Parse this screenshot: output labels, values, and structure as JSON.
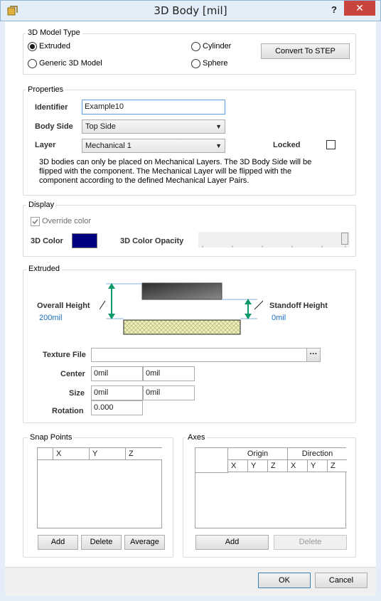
{
  "window": {
    "title": "3D Body [mil]",
    "help_label": "?",
    "close_label": "✕"
  },
  "model_type": {
    "legend": "3D Model Type",
    "options": [
      {
        "label": "Extruded",
        "selected": true
      },
      {
        "label": "Generic 3D Model",
        "selected": false
      },
      {
        "label": "Cylinder",
        "selected": false
      },
      {
        "label": "Sphere",
        "selected": false
      }
    ],
    "convert_label": "Convert To STEP"
  },
  "properties": {
    "legend": "Properties",
    "identifier_label": "Identifier",
    "identifier_value": "Example10",
    "body_side_label": "Body Side",
    "body_side_value": "Top Side",
    "layer_label": "Layer",
    "layer_value": "Mechanical 1",
    "locked_label": "Locked",
    "locked": false,
    "note": "3D bodies can only be placed on Mechanical Layers. The 3D Body Side will be flipped with the component. The Mechanical Layer will be flipped with the component according to the defined Mechanical Layer Pairs."
  },
  "display": {
    "legend": "Display",
    "override_label": "Override color",
    "override_checked": true,
    "color_label": "3D Color",
    "color_value": "#000080",
    "opacity_label": "3D Color Opacity",
    "opacity_fraction": 1.0
  },
  "extruded": {
    "legend": "Extruded",
    "overall_height_label": "Overall Height",
    "overall_height_value": "200mil",
    "standoff_height_label": "Standoff Height",
    "standoff_height_value": "0mil",
    "texture_label": "Texture File",
    "texture_value": "",
    "browse_label": "···",
    "center_label": "Center",
    "center_x": "0mil",
    "center_y": "0mil",
    "size_label": "Size",
    "size_x": "0mil",
    "size_y": "0mil",
    "rotation_label": "Rotation",
    "rotation_value": "0.000"
  },
  "snap_points": {
    "legend": "Snap Points",
    "columns": [
      "X",
      "Y",
      "Z"
    ],
    "add_label": "Add",
    "delete_label": "Delete",
    "average_label": "Average"
  },
  "axes": {
    "legend": "Axes",
    "group_origin": "Origin",
    "group_direction": "Direction",
    "columns": [
      "X",
      "Y",
      "Z",
      "X",
      "Y",
      "Z"
    ],
    "add_label": "Add",
    "delete_label": "Delete"
  },
  "footer": {
    "ok_label": "OK",
    "cancel_label": "Cancel"
  },
  "colors": {
    "accent_green": "#0a9a6a",
    "hatch_fill": "#f0f0b8",
    "dark_body": "#5a5a5a"
  }
}
